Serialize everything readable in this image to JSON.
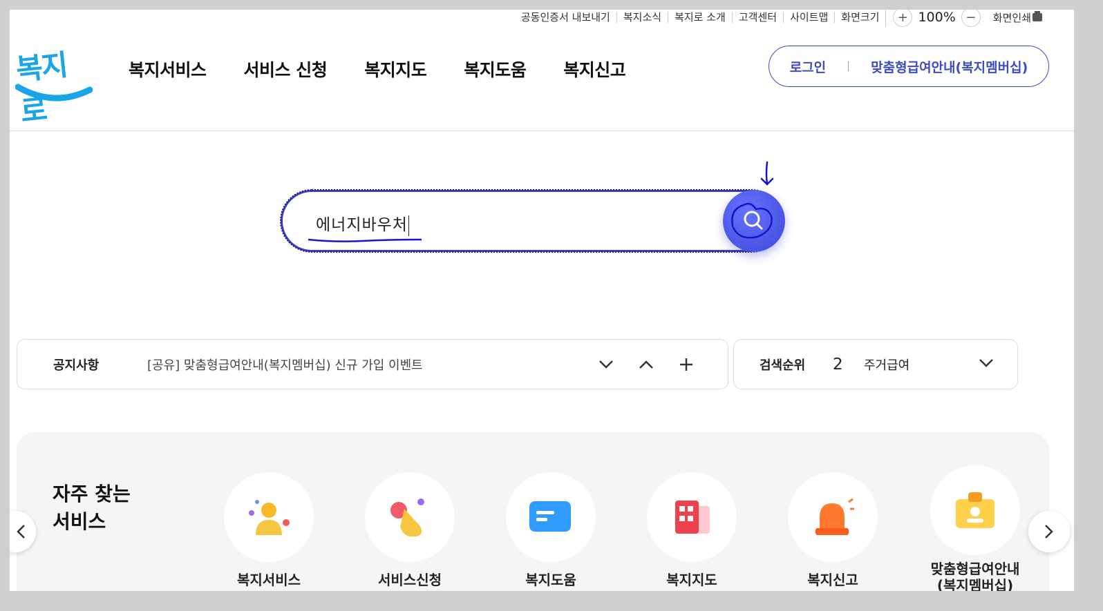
{
  "utility": {
    "items": [
      "공동인증서 내보내기",
      "복지소식",
      "복지로 소개",
      "고객센터",
      "사이트맵",
      "화면크기"
    ],
    "zoom_plus": "+",
    "zoom_value": "100%",
    "zoom_minus": "−",
    "print_label": "화면인쇄"
  },
  "logo": {
    "text": "복지로"
  },
  "gnb": {
    "items": [
      "복지서비스",
      "서비스 신청",
      "복지지도",
      "복지도움",
      "복지신고"
    ]
  },
  "account": {
    "login": "로그인",
    "membership": "맞춤형급여안내(복지멤버십)"
  },
  "search": {
    "value": "에너지바우처"
  },
  "notice": {
    "label": "공지사항",
    "text": "[공유] 맞춤형급여안내(복지멤버십) 신규 가입 이벤트"
  },
  "rank": {
    "label": "검색순위",
    "number": "2",
    "keyword": "주거급여"
  },
  "frequent": {
    "title_line1": "자주 찾는",
    "title_line2": "서비스",
    "services": [
      {
        "label": "복지서비스",
        "icon": "person-icon"
      },
      {
        "label": "서비스신청",
        "icon": "tap-hand-icon"
      },
      {
        "label": "복지도움",
        "icon": "chat-icon"
      },
      {
        "label": "복지지도",
        "icon": "building-icon"
      },
      {
        "label": "복지신고",
        "icon": "siren-icon"
      },
      {
        "label": "맞춤형급여안내",
        "label2": "(복지멤버십)",
        "icon": "id-badge-icon"
      }
    ]
  },
  "colors": {
    "brand": "#3b4cc0",
    "accent": "#4f5bea",
    "logo_blue": "#1aa5e8"
  }
}
